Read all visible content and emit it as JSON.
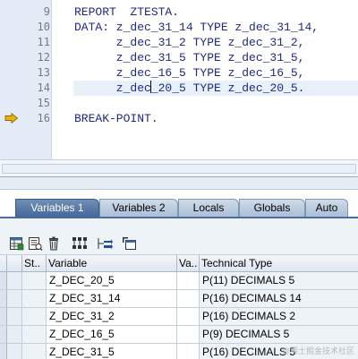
{
  "editor": {
    "lines": [
      {
        "num": "9",
        "code": "REPORT  ZTESTA."
      },
      {
        "num": "10",
        "code": "DATA: z_dec_31_14 TYPE z_dec_31_14,"
      },
      {
        "num": "11",
        "code": "      z_dec_31_2 TYPE z_dec_31_2,"
      },
      {
        "num": "12",
        "code": "      z_dec_31_5 TYPE z_dec_31_5,"
      },
      {
        "num": "13",
        "code": "      z_dec_16_5 TYPE z_dec_16_5,"
      },
      {
        "num": "14",
        "code_before_caret": "      z_dec",
        "code_after_caret": "_20_5 TYPE z_dec_20_5."
      },
      {
        "num": "15",
        "code": ""
      },
      {
        "num": "16",
        "code": "BREAK-POINT."
      }
    ]
  },
  "tabs": [
    "Variables 1",
    "Variables 2",
    "Locals",
    "Globals",
    "Auto"
  ],
  "toolbar": {
    "icons": [
      "table-layout-icon",
      "details-icon",
      "delete-icon",
      "hierarchy-icon",
      "navigate-icon",
      "new-window-icon"
    ]
  },
  "table": {
    "headers": {
      "status": "St..",
      "variable": "Variable",
      "va": "Va..",
      "technical_type": "Technical Type"
    },
    "rows": [
      {
        "variable": "Z_DEC_20_5",
        "technical_type": "P(11) DECIMALS 5"
      },
      {
        "variable": "Z_DEC_31_14",
        "technical_type": "P(16) DECIMALS 14"
      },
      {
        "variable": "Z_DEC_31_2",
        "technical_type": "P(16) DECIMALS 2"
      },
      {
        "variable": "Z_DEC_16_5",
        "technical_type": "P(9) DECIMALS 5"
      },
      {
        "variable": "Z_DEC_31_5",
        "technical_type": "P(16) DECIMALS 5"
      }
    ]
  },
  "watermark": "@稀土掘金技术社区",
  "colors": {
    "keyword": "#1d2a8a",
    "active_tab": "#4a6d9e",
    "exec_arrow": "#f0b400"
  }
}
